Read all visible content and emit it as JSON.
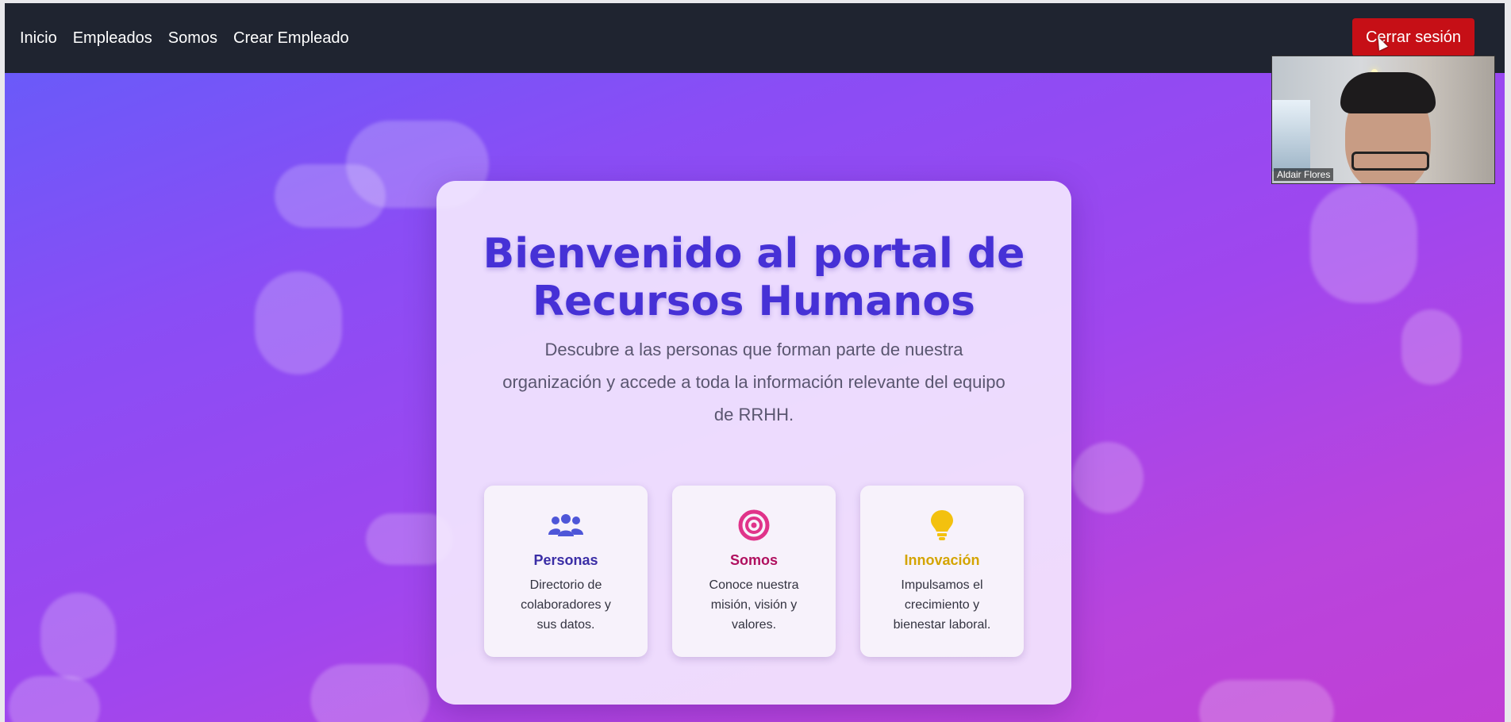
{
  "navbar": {
    "links": [
      "Inicio",
      "Empleados",
      "Somos",
      "Crear Empleado"
    ],
    "logout_label": "Cerrar sesión"
  },
  "webcam": {
    "participant_name": "Aldair Flores"
  },
  "hero": {
    "title": "Bienvenido al portal de Recursos Humanos",
    "subtitle": "Descubre a las personas que forman parte de nuestra organización y accede a toda la información relevante del equipo de RRHH.",
    "features": [
      {
        "icon": "users-icon",
        "title": "Personas",
        "text": "Directorio de colaboradores y sus datos.",
        "color": "#3b2ea6"
      },
      {
        "icon": "target-icon",
        "title": "Somos",
        "text": "Conoce nuestra misión, visión y valores.",
        "color": "#b0105f"
      },
      {
        "icon": "lightbulb-icon",
        "title": "Innovación",
        "text": "Impulsamos el crecimiento y bienestar laboral.",
        "color": "#d4a400"
      }
    ]
  },
  "colors": {
    "navbar_bg": "#1f2430",
    "logout_bg": "#c60f16",
    "title_color": "#4631d6",
    "users_icon": "#4e56d8",
    "target_icon": "#e0338a",
    "bulb_icon": "#f3c10f"
  }
}
